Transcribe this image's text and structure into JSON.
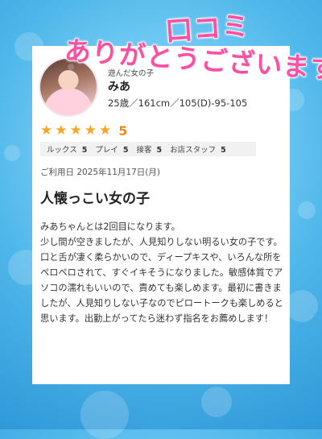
{
  "headline": {
    "kuchikomi": "口コミ",
    "thanks": "ありがとうございます"
  },
  "profile": {
    "genre": "遊んだ女の子",
    "name": "みあ",
    "stats": "25歳／161cm／105(D)-95-105"
  },
  "rating": {
    "stars": 5,
    "score": "5",
    "star_color": "#f6a623",
    "categories": [
      {
        "label": "ルックス",
        "value": "5"
      },
      {
        "label": "プレイ",
        "value": "5"
      },
      {
        "label": "接客",
        "value": "5"
      },
      {
        "label": "お店スタッフ",
        "value": "5"
      }
    ]
  },
  "review": {
    "date": "ご利用日 2025年11月17日(月)",
    "title": "人懐っこい女の子",
    "body": "みあちゃんとは2回目になります。\n少し間が空きましたが、人見知りしない明るい女の子です。口と舌が凄く柔らかいので、ディープキスや、いろんな所をペロペロされて、すぐイキそうになりました。敏感体質でアソコの濡れもいいので、責めても楽しめます。最初に書きましたが、人見知りしない子なのでピロートークも楽しめると思います。出勤上がってたら迷わず指名をお薦めします！"
  },
  "colors": {
    "headline_pink": "#ff4fa0",
    "background_blue": "#4fb7ea"
  }
}
